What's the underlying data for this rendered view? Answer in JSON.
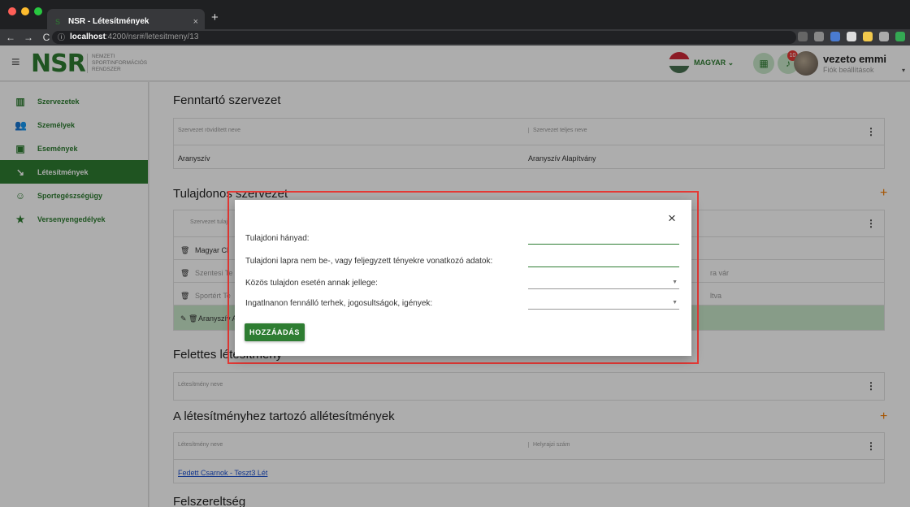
{
  "browser": {
    "tab_title": "NSR - Létesítmények",
    "tab_close": "×",
    "new_tab": "+",
    "url_host": "localhost",
    "url_path": ":4200/nsr#/letesitmeny/13",
    "nav": [
      "←",
      "→",
      "C"
    ]
  },
  "header": {
    "menu_icon": "≡",
    "logo": "NSR",
    "logo_sub": [
      "NEMZETI",
      "SPORTINFORMÁCIÓS",
      "RENDSZER"
    ],
    "language": "MAGYAR ⌄",
    "notification_count": "10",
    "user_name": "vezeto emmi",
    "user_sub": "Fiók beállítások",
    "caret": "▾"
  },
  "sidebar": {
    "items": [
      {
        "icon": "▥",
        "label": "Szervezetek"
      },
      {
        "icon": "👥",
        "label": "Személyek"
      },
      {
        "icon": "▣",
        "label": "Események"
      },
      {
        "icon": "↘",
        "label": "Létesítmények"
      },
      {
        "icon": "☺",
        "label": "Sportegészségügy"
      },
      {
        "icon": "★",
        "label": "Versenyengedélyek"
      }
    ]
  },
  "main": {
    "fenntarto": {
      "title": "Fenntartó szervezet",
      "col_a": "Szervezet rövidített neve",
      "col_b": "Szervezet teljes neve",
      "row_a": "Aranyszív",
      "row_b": "Aranyszív Alapítvány"
    },
    "tulajdonos": {
      "title": "Tulajdonos szervezet",
      "col_a": "Szervezet tulaj",
      "rows": [
        "Magyar Cl",
        "Szentesi Te",
        "Sportért Te",
        "Aranyszív A"
      ],
      "right_texts": [
        "",
        "ra vár",
        "ltva",
        ""
      ]
    },
    "felettes": {
      "title": "Felettes létesítmény",
      "col_a": "Létesítmény neve"
    },
    "alletesitmenyek": {
      "title": "A létesítményhez tartozó allétesítmények",
      "col_a": "Létesítmény neve",
      "col_b": "Helyrajzi szám",
      "row_a": "Fedett Csarnok - Teszt3 Lét"
    },
    "felszereltseg": {
      "title": "Felszereltség"
    },
    "kebab": "⋮",
    "plus": "+"
  },
  "dialog": {
    "close": "×",
    "fields": [
      "Tulajdoni hányad:",
      "Tulajdoni lapra nem be-, vagy feljegyzett tényekre vonatkozó adatok:",
      "Közös tulajdon esetén annak jellege:",
      "Ingatlnanon fennálló terhek, jogosultságok, igények:"
    ],
    "add_button": "HOZZÁADÁS"
  }
}
